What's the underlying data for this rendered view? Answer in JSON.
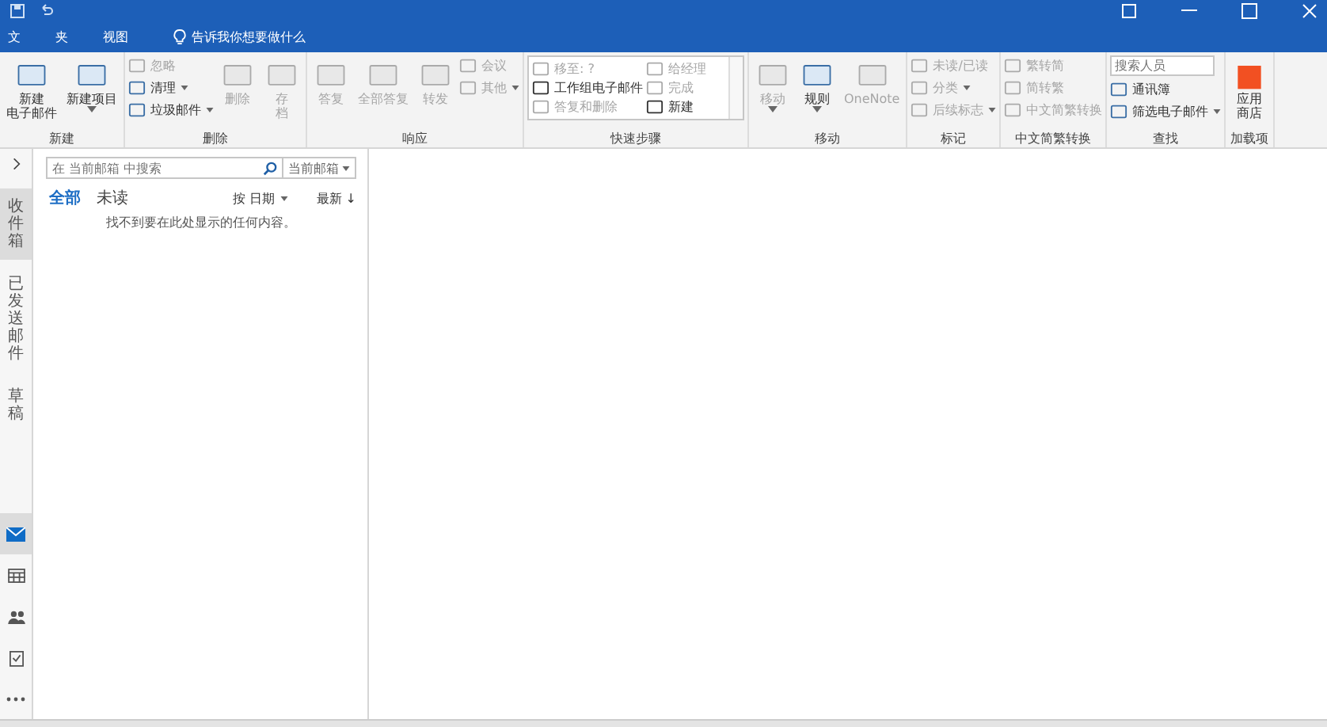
{
  "tabs": [
    {
      "label": "文"
    },
    {
      "label": "夹"
    },
    {
      "label": "视图"
    }
  ],
  "tell_me": "告诉我你想要做什么",
  "ribbon": {
    "groups": [
      {
        "label": "新建",
        "items": [
          {
            "kind": "large",
            "lines": [
              "新建",
              "电子邮件"
            ],
            "disabled": false
          },
          {
            "kind": "large",
            "lines": [
              "新建项目"
            ],
            "disabled": false,
            "dropdown": true
          }
        ]
      },
      {
        "label": "删除",
        "items": [
          {
            "kind": "small",
            "label": "忽略",
            "disabled": true
          },
          {
            "kind": "small",
            "label": "清理",
            "disabled": false,
            "dropdown": true
          },
          {
            "kind": "small",
            "label": "垃圾邮件",
            "disabled": false,
            "dropdown": true
          },
          {
            "kind": "large",
            "lines": [
              "删除"
            ],
            "disabled": true
          },
          {
            "kind": "large",
            "lines": [
              "存",
              "档"
            ],
            "disabled": true
          }
        ]
      },
      {
        "label": "响应",
        "items": [
          {
            "kind": "large",
            "lines": [
              "答复"
            ],
            "disabled": true
          },
          {
            "kind": "large",
            "lines": [
              "全部答复"
            ],
            "disabled": true
          },
          {
            "kind": "large",
            "lines": [
              "转发"
            ],
            "disabled": true
          },
          {
            "kind": "small",
            "label": "会议",
            "disabled": true
          },
          {
            "kind": "small",
            "label": "其他",
            "disabled": true,
            "dropdown": true
          }
        ]
      },
      {
        "label": "快速步骤",
        "items": [
          {
            "kind": "gallery",
            "label": "移至: ?",
            "disabled": true
          },
          {
            "kind": "gallery",
            "label": "给经理",
            "disabled": true
          },
          {
            "kind": "gallery",
            "label": "工作组电子邮件",
            "disabled": false
          },
          {
            "kind": "gallery",
            "label": "完成",
            "disabled": true
          },
          {
            "kind": "gallery",
            "label": "答复和删除",
            "disabled": true
          },
          {
            "kind": "gallery",
            "label": "新建",
            "disabled": false
          }
        ]
      },
      {
        "label": "移动",
        "items": [
          {
            "kind": "large",
            "lines": [
              "移动"
            ],
            "disabled": true,
            "dropdown": true
          },
          {
            "kind": "large",
            "lines": [
              "规则"
            ],
            "disabled": false,
            "dropdown": true
          },
          {
            "kind": "large",
            "lines": [
              "OneNote"
            ],
            "disabled": true
          }
        ]
      },
      {
        "label": "标记",
        "items": [
          {
            "kind": "small",
            "label": "未读/已读",
            "disabled": true
          },
          {
            "kind": "small",
            "label": "分类",
            "disabled": true,
            "dropdown": true
          },
          {
            "kind": "small",
            "label": "后续标志",
            "disabled": true,
            "dropdown": true
          }
        ]
      },
      {
        "label": "中文简繁转换",
        "items": [
          {
            "kind": "small",
            "label": "繁转简",
            "disabled": true
          },
          {
            "kind": "small",
            "label": "简转繁",
            "disabled": true
          },
          {
            "kind": "small",
            "label": "中文简繁转换",
            "disabled": true
          }
        ]
      },
      {
        "label": "查找",
        "items": [
          {
            "kind": "field",
            "placeholder": "搜索人员"
          },
          {
            "kind": "small",
            "label": "通讯簿",
            "disabled": false
          },
          {
            "kind": "small",
            "label": "筛选电子邮件",
            "disabled": false,
            "dropdown": true
          }
        ]
      },
      {
        "label": "加载项",
        "items": [
          {
            "kind": "large",
            "lines": [
              "应用",
              "商店"
            ],
            "disabled": false
          }
        ]
      }
    ]
  },
  "nav_folders": [
    {
      "label": "收件箱",
      "selected": true
    },
    {
      "label": "已发送邮件",
      "selected": false
    },
    {
      "label": "草稿",
      "selected": false
    }
  ],
  "nav_modules": [
    {
      "kind": "mail",
      "selected": true
    },
    {
      "kind": "calendar",
      "selected": false
    },
    {
      "kind": "people",
      "selected": false
    },
    {
      "kind": "tasks",
      "selected": false
    },
    {
      "kind": "more",
      "selected": false
    }
  ],
  "folder_pane": {
    "search_placeholder": "在 当前邮箱 中搜索",
    "scope": "当前邮箱",
    "filters": [
      {
        "label": "全部",
        "selected": true
      },
      {
        "label": "未读",
        "selected": false
      }
    ],
    "sort": "按 日期",
    "order": "最新 ↓",
    "empty_message": "找不到要在此处显示的任何内容。"
  }
}
